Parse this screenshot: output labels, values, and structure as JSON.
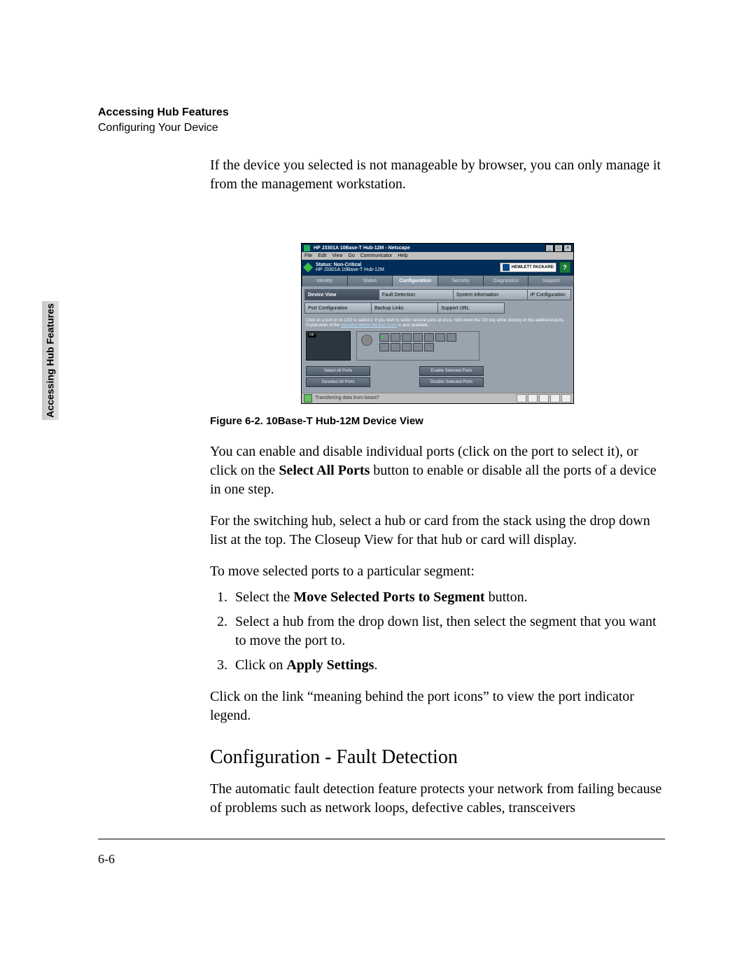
{
  "running_head": {
    "bold": "Accessing Hub Features",
    "sub": "Configuring Your Device"
  },
  "side_tab": "Accessing Hub Features",
  "para1": "If the device you selected is not manageable by browser, you can only manage it from the management workstation.",
  "figure_caption": "Figure 6-2.   10Base-T Hub-12M Device View",
  "para2a": "You can enable and disable individual ports (click on the port to select it), or click on the ",
  "para2b_bold": "Select All Ports",
  "para2c": " button to enable or disable all the ports of a device in one step.",
  "para3": "For the switching hub, select a hub or card from the stack using the drop down list at the top. The Closeup View for that hub or card will display.",
  "para4": "To move selected ports to a particular segment:",
  "steps": {
    "s1a": "Select the ",
    "s1b_bold": "Move Selected Ports to Segment",
    "s1c": " button.",
    "s2": "Select a hub from the drop down list, then select the segment that you want to move the port to.",
    "s3a": "Click on ",
    "s3b_bold": "Apply Settings",
    "s3c": "."
  },
  "para5": "Click on the link “meaning behind the port icons” to view the port indicator legend.",
  "heading2": "Configuration - Fault Detection",
  "para6": "The automatic fault detection feature protects your network from failing because of problems such as network loops, defective cables, transceivers",
  "page_num": "6-6",
  "shot": {
    "title": "HP J3301A 10Base-T Hub-12M - Netscape",
    "menus": [
      "File",
      "Edit",
      "View",
      "Go",
      "Communicator",
      "Help"
    ],
    "status_label": "Status: Non-Critical",
    "device_line": "HP J3301A 10Base-T Hub-12M",
    "hp_logo_text": "HEWLETT PACKARD",
    "help_q": "?",
    "nav": [
      "Identity",
      "Status",
      "Configuration",
      "Security",
      "Diagnostics",
      "Support"
    ],
    "subtabs_row1": [
      "Device View",
      "Fault Detection",
      "System Information",
      "IP Configuration"
    ],
    "subtabs_row2": [
      "Port Configuration",
      "Backup Links",
      "Support URL"
    ],
    "hint_a": "Click on a port or its LED to select it. If you wish to select several ports at once, hold down the Ctrl key while clicking on the additional ports. Explanation of the ",
    "hint_link": "meaning behind the port icons",
    "hint_b": " is also available.",
    "btns": {
      "sel_all": "Select All Ports",
      "desel_all": "Deselect All Ports",
      "enable": "Enable Selected Ports",
      "disable": "Disable Selected Ports"
    },
    "statusbar": "Transferring data from beast7",
    "win_min": "_",
    "win_max": "□",
    "win_close": "×"
  }
}
